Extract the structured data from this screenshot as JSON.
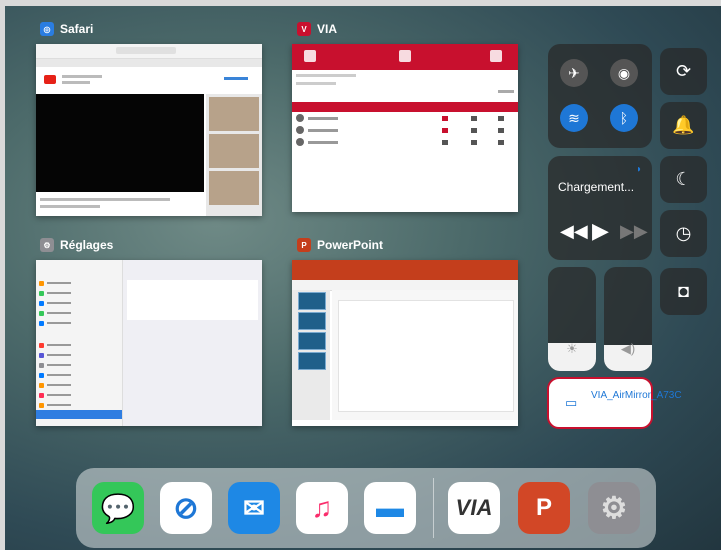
{
  "switcher": {
    "cards": [
      {
        "app": "Safari",
        "icon": "safari-app-icon"
      },
      {
        "app": "VIA",
        "icon": "via-app-icon"
      },
      {
        "app": "Réglages",
        "icon": "settings-app-icon"
      },
      {
        "app": "PowerPoint",
        "icon": "powerpoint-app-icon"
      }
    ]
  },
  "control_center": {
    "media": {
      "title": "Chargement..."
    },
    "airplay": {
      "device_name": "VIA_AirMirror_A73C"
    },
    "brightness_level": 0.27,
    "volume_level": 0.25,
    "toggles": [
      {
        "name": "airplane-mode",
        "active": false
      },
      {
        "name": "cellular-data",
        "active": false
      },
      {
        "name": "wifi",
        "active": true
      },
      {
        "name": "bluetooth",
        "active": true
      }
    ],
    "accent": "#1e77d6"
  },
  "dock": {
    "apps": [
      "messages-icon",
      "safari-icon",
      "mail-icon",
      "music-icon",
      "files-icon",
      "via-icon",
      "powerpoint-icon",
      "settings-icon"
    ],
    "via_label": "VIA",
    "ppt_label": "P"
  }
}
